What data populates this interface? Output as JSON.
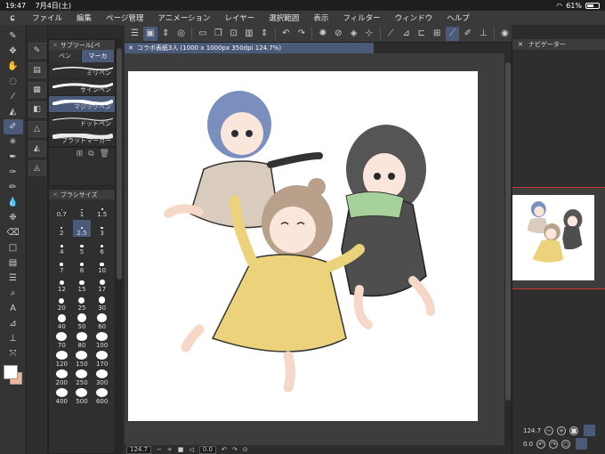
{
  "status": {
    "time": "19:47",
    "date": "7月4日(土)",
    "battery": "61%",
    "battery_level": 0.61
  },
  "menu": {
    "items": [
      "ファイル",
      "編集",
      "ページ管理",
      "アニメーション",
      "レイヤー",
      "選択範囲",
      "表示",
      "フィルター",
      "ウィンドウ",
      "ヘルプ"
    ]
  },
  "subtool": {
    "title": "サブツール[ペ",
    "tabs": [
      "ペン",
      "マーカ"
    ],
    "brushes": [
      "ミリペン",
      "サインペン",
      "マジックペン",
      "ドットペン",
      "フラットマーカー"
    ],
    "selected_brush": "マジックペン"
  },
  "brushsize": {
    "title": "ブラシサイズ",
    "sizes": [
      "0.7",
      "1",
      "1.5",
      "2",
      "2.5",
      "3",
      "4",
      "5",
      "6",
      "7",
      "8",
      "10",
      "12",
      "15",
      "17",
      "20",
      "25",
      "30",
      "40",
      "50",
      "60",
      "70",
      "80",
      "100",
      "120",
      "150",
      "170",
      "200",
      "250",
      "300",
      "400",
      "500",
      "600"
    ],
    "selected": "2.5"
  },
  "canvas": {
    "tab_title": "コラボ表紙3人 (1000 x 1000px 350dpi 124.7%)",
    "zoom": "124.7",
    "angle": "0.0"
  },
  "navigator": {
    "title": "ナビゲーター",
    "zoom": "124.7",
    "angle": "0.0"
  },
  "colors": {
    "accent": "#4a5a78",
    "main_color": "#ffffff",
    "sub_color": "#f2b49a"
  },
  "icons": {
    "toolstrip": [
      "pen-icon",
      "move-icon",
      "hand-icon",
      "lasso-icon",
      "eyedropper-icon",
      "fill-icon",
      "brush-icon",
      "sparkle-icon",
      "pen-nib-icon",
      "marker-icon",
      "pencil-icon",
      "drop-icon",
      "airbrush-icon",
      "eraser-icon",
      "rect-icon",
      "gradient-icon",
      "layer-icon",
      "zoom-icon",
      "text-icon",
      "ruler-icon",
      "stamp-icon",
      "transform-icon"
    ]
  }
}
